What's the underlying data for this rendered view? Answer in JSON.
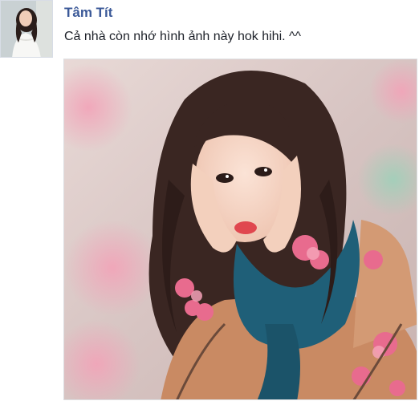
{
  "post": {
    "author": "Tâm Tít",
    "text": "Cả nhà còn nhớ hình ảnh này hok hihi. ^^"
  },
  "colors": {
    "author_link": "#3b5998",
    "text": "#1d2129",
    "scarf": "#1f5f78",
    "sweater": "#c98a63",
    "blossom": "#e86b8e"
  },
  "icons": {
    "avatar": "profile-photo",
    "photo": "post-photo"
  }
}
